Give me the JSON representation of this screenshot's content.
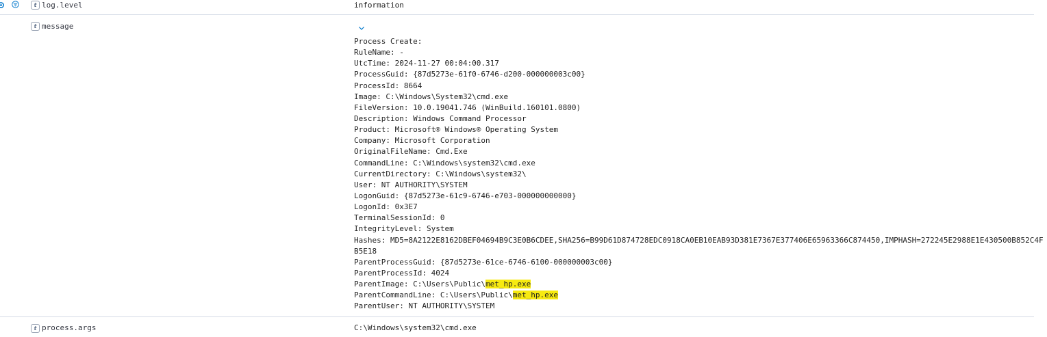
{
  "rows": {
    "log_level": {
      "field": "log.level",
      "value": "information",
      "type_badge": "t"
    },
    "message": {
      "field": "message",
      "type_badge": "t",
      "lines": [
        {
          "text": "Process Create:"
        },
        {
          "text": "RuleName: -"
        },
        {
          "text": "UtcTime: 2024-11-27 00:04:00.317"
        },
        {
          "text": "ProcessGuid: {87d5273e-61f0-6746-d200-000000003c00}"
        },
        {
          "text": "ProcessId: 8664"
        },
        {
          "text": "Image: C:\\Windows\\System32\\cmd.exe"
        },
        {
          "text": "FileVersion: 10.0.19041.746 (WinBuild.160101.0800)"
        },
        {
          "text": "Description: Windows Command Processor"
        },
        {
          "text": "Product: Microsoft® Windows® Operating System"
        },
        {
          "text": "Company: Microsoft Corporation"
        },
        {
          "text": "OriginalFileName: Cmd.Exe"
        },
        {
          "text": "CommandLine: C:\\Windows\\system32\\cmd.exe"
        },
        {
          "text": "CurrentDirectory: C:\\Windows\\system32\\"
        },
        {
          "text": "User: NT AUTHORITY\\SYSTEM"
        },
        {
          "text": "LogonGuid: {87d5273e-61c9-6746-e703-000000000000}"
        },
        {
          "text": "LogonId: 0x3E7"
        },
        {
          "text": "TerminalSessionId: 0"
        },
        {
          "text": "IntegrityLevel: System"
        },
        {
          "text": "Hashes: MD5=8A2122E8162DBEF04694B9C3E0B6CDEE,SHA256=B99D61D874728EDC0918CA0EB10EAB93D381E7367E377406E65963366C874450,IMPHASH=272245E2988E1E430500B852C4F"
        },
        {
          "text": "B5E18"
        },
        {
          "text": "ParentProcessGuid: {87d5273e-61ce-6746-6100-000000003c00}"
        },
        {
          "text": "ParentProcessId: 4024"
        },
        {
          "text": "ParentImage: C:\\Users\\Public\\",
          "highlight": "met_hp.exe"
        },
        {
          "text": "ParentCommandLine: C:\\Users\\Public\\",
          "highlight": "met_hp.exe"
        },
        {
          "text": "ParentUser: NT AUTHORITY\\SYSTEM"
        }
      ]
    },
    "process_args": {
      "field": "process.args",
      "value": "C:\\Windows\\system32\\cmd.exe",
      "type_badge": "t"
    }
  },
  "icons": {
    "toggle_details": "gear-icon",
    "filter_for_value": "filter-icon",
    "expand_message": "chevron-down-icon"
  },
  "colors": {
    "highlight": "#f7ea10",
    "accent": "#0077cc",
    "divider": "#d3dae6"
  }
}
